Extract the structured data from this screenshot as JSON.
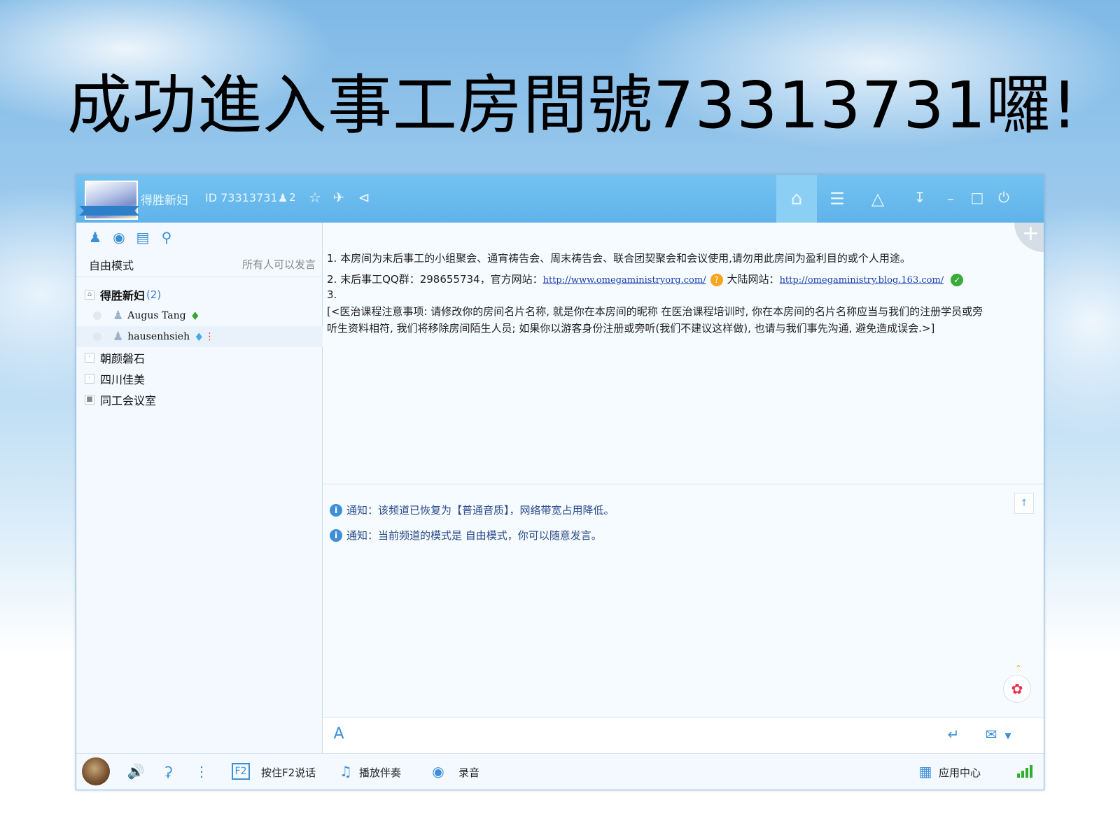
{
  "slide": {
    "title": "成功進入事工房間號73313731囉!"
  },
  "titlebar": {
    "room_name": "得胜新妇",
    "room_id": "ID 73313731",
    "member_count": "2",
    "icons": [
      "user-icon",
      "star-icon",
      "plane-icon",
      "share-icon",
      "home-icon",
      "list-icon",
      "gamepad-icon",
      "download-icon",
      "minimize-icon",
      "maximize-icon",
      "power-icon"
    ]
  },
  "sidebar": {
    "tools": [
      "members-icon",
      "location-icon",
      "board-icon",
      "search-icon"
    ],
    "mode_label": "自由模式",
    "mode_desc": "所有人可以发言",
    "tree": [
      {
        "label": "得胜新妇",
        "count": "(2)",
        "type": "channel-open"
      },
      {
        "label": "Augus Tang",
        "type": "user"
      },
      {
        "label": "hausenhsieh",
        "type": "user"
      },
      {
        "label": "朝颜磐石",
        "type": "channel"
      },
      {
        "label": "四川佳美",
        "type": "channel"
      },
      {
        "label": "同工会议室",
        "type": "channel-locked"
      }
    ]
  },
  "announcement": {
    "line1": "1. 本房间为末后事工的小组聚会、通宵祷告会、周末祷告会、联合团契聚会和会议使用,请勿用此房间为盈利目的或个人用途。",
    "line2_prefix": "2. 末后事工QQ群：298655734，官方网站：",
    "line2_link1": "http://www.omegaministryorg.com/",
    "line2_mid": "大陆网站：",
    "line2_link2": "http://omegaministry.blog.163.com/",
    "line3": "3.",
    "line4": "[<医治课程注意事项: 请修改你的房间名片名称, 就是你在本房间的昵称 在医治课程培训时, 你在本房间的名片名称应当与我们的注册学员或旁",
    "line5": "听生资料相符, 我们将移除房间陌生人员; 如果你以游客身份注册或旁听(我们不建议这样做), 也请与我们事先沟通, 避免造成误会.>]"
  },
  "chat": {
    "notices": [
      "通知：该频道已恢复为【普通音质】，网络带宽占用降低。",
      "通知：当前频道的模式是 自由模式，你可以随意发言。"
    ]
  },
  "input": {
    "placeholder": ""
  },
  "bottombar": {
    "f2_label": "按住F2说话",
    "music_label": "播放伴奏",
    "record_label": "录音",
    "app_center_label": "应用中心"
  },
  "colors": {
    "titlebar": "#5fb3ea",
    "accent": "#3f8fd8",
    "link": "#1a3fb0"
  }
}
